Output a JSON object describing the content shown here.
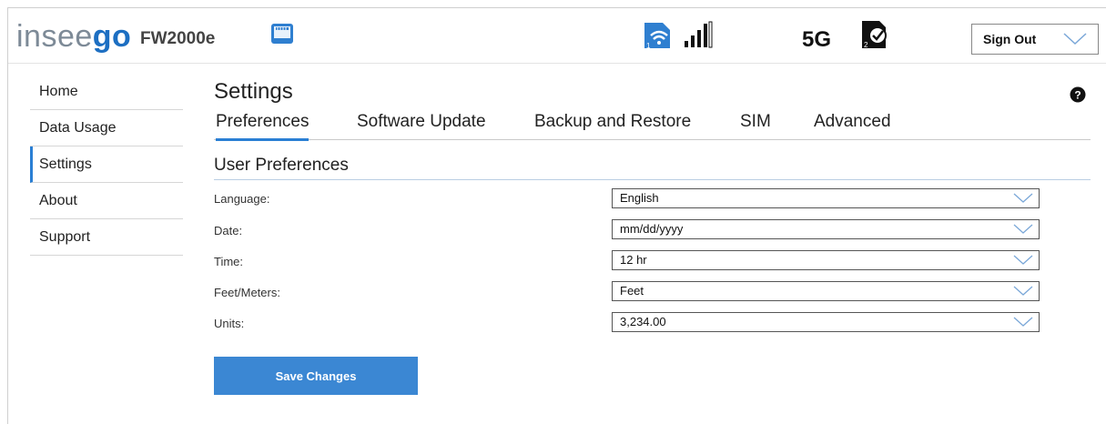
{
  "header": {
    "logo_part1": "insee",
    "logo_part2": "go",
    "model": "FW2000e",
    "network_label": "5G",
    "signout_label": "Sign Out",
    "wifi_badge": "1",
    "sim_badge": "2"
  },
  "sidebar": {
    "items": [
      {
        "label": "Home"
      },
      {
        "label": "Data Usage"
      },
      {
        "label": "Settings"
      },
      {
        "label": "About"
      },
      {
        "label": "Support"
      }
    ]
  },
  "main": {
    "title": "Settings",
    "tabs": [
      {
        "label": "Preferences"
      },
      {
        "label": "Software Update"
      },
      {
        "label": "Backup and Restore"
      },
      {
        "label": "SIM"
      },
      {
        "label": "Advanced"
      }
    ],
    "section_title": "User Preferences",
    "fields": [
      {
        "label": "Language:",
        "value": "English"
      },
      {
        "label": "Date:",
        "value": "mm/dd/yyyy"
      },
      {
        "label": "Time:",
        "value": "12 hr"
      },
      {
        "label": "Feet/Meters:",
        "value": "Feet"
      },
      {
        "label": "Units:",
        "value": "3,234.00"
      }
    ],
    "save_label": "Save Changes"
  },
  "colors": {
    "accent": "#2a7fd4",
    "button": "#3b87d3",
    "logo_gray": "#7d8a97",
    "logo_blue": "#1d6fc2"
  },
  "icons": [
    "ethernet-icon",
    "wifi-icon",
    "signal-bars-icon",
    "sim-check-icon",
    "chevron-down-icon",
    "help-icon"
  ]
}
